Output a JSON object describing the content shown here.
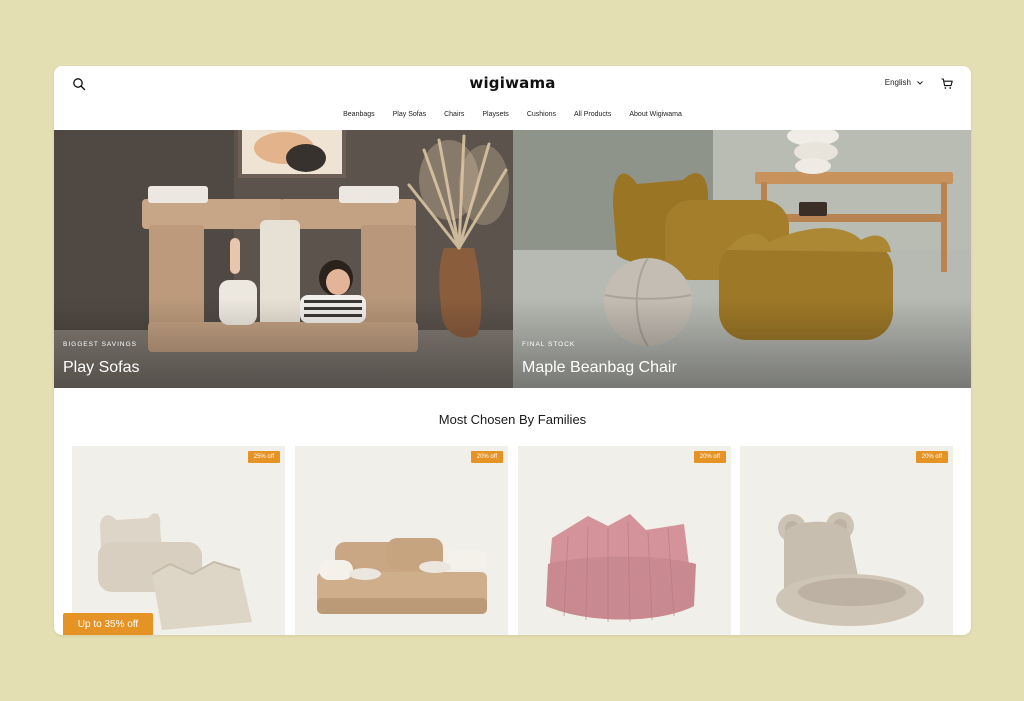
{
  "header": {
    "logo": "wigiwama",
    "language": "English",
    "icons": {
      "search": "search-icon",
      "cart": "cart-icon",
      "chevron": "chevron-down-icon"
    }
  },
  "nav": {
    "items": [
      "Beanbags",
      "Play Sofas",
      "Chairs",
      "Playsets",
      "Cushions",
      "All Products",
      "About Wigiwama"
    ]
  },
  "hero": [
    {
      "eyebrow": "BIGGEST SAVINGS",
      "title": "Play Sofas"
    },
    {
      "eyebrow": "FINAL STOCK",
      "title": "Maple Beanbag Chair"
    }
  ],
  "section": {
    "title": "Most Chosen By Families"
  },
  "products": [
    {
      "badge": "25% off"
    },
    {
      "badge": "20% off"
    },
    {
      "badge": "20% off"
    },
    {
      "badge": "20% off"
    }
  ],
  "promo": {
    "label": "Up to 35% off"
  },
  "colors": {
    "background": "#e4dfb2",
    "accent": "#e59324",
    "card": "#f1efe9"
  }
}
